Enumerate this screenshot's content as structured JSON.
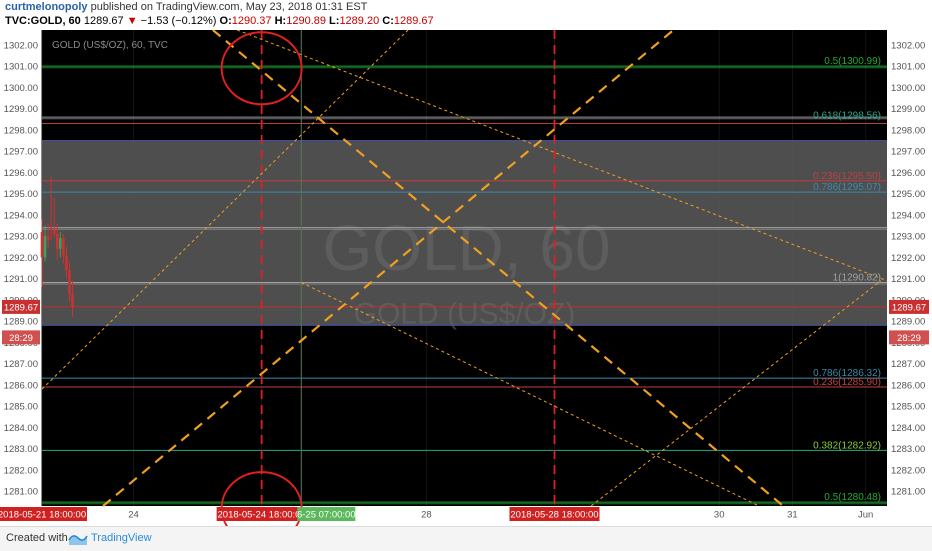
{
  "header": {
    "author": "curtmelonopoly",
    "published": "published on TradingView.com, May 23, 2018 01:31 EST",
    "symbol": "TVC:GOLD, 60",
    "last": "1289.67",
    "change_arrow": "▼",
    "change": "−1.53 (−0.12%)",
    "o_label": "O:",
    "o_val": "1290.37",
    "h_label": "H:",
    "h_val": "1290.89",
    "l_label": "L:",
    "l_val": "1289.20",
    "c_label": "C:",
    "c_val": "1289.67"
  },
  "chart_data": {
    "type": "candlestick",
    "legend": "GOLD (US$/OZ), 60, TVC",
    "watermark_title": "GOLD, 60",
    "watermark_subtitle": "GOLD (US$/OZ)",
    "ylim": [
      1280.3,
      1302.7
    ],
    "y_ticks": [
      "1302.00",
      "1301.00",
      "1300.00",
      "1299.00",
      "1298.00",
      "1297.00",
      "1296.00",
      "1295.00",
      "1294.00",
      "1293.00",
      "1292.00",
      "1291.00",
      "1290.00",
      "1289.00",
      "1288.00",
      "1287.00",
      "1286.00",
      "1285.00",
      "1284.00",
      "1283.00",
      "1282.00",
      "1281.00"
    ],
    "x_range": [
      "2018-05-21 18:00",
      "2018-06-01 12:00"
    ],
    "x_ticks": [
      {
        "label": "2018-05-21 18:00:00",
        "t": 0,
        "highlight": "red"
      },
      {
        "label": "24",
        "t": 30
      },
      {
        "label": "2018-05-24 18:00:00",
        "t": 72,
        "highlight": "red"
      },
      {
        "label": "6-25 07:00:00",
        "t": 85,
        "highlight": "green"
      },
      {
        "label": "28",
        "t": 126
      },
      {
        "label": "2018-05-28 18:00:00",
        "t": 168,
        "highlight": "red"
      },
      {
        "label": "30",
        "t": 222
      },
      {
        "label": "31",
        "t": 246
      },
      {
        "label": "Jun",
        "t": 270
      }
    ],
    "price_badges": [
      {
        "label": "1289.67",
        "price": 1289.67
      },
      {
        "label": "28:29",
        "price": 1288.8
      }
    ],
    "candles": [
      {
        "t": 0,
        "o": 1293.2,
        "h": 1293.8,
        "l": 1290.6,
        "c": 1292.0
      },
      {
        "t": 1,
        "o": 1292.0,
        "h": 1293.5,
        "l": 1291.8,
        "c": 1293.0
      },
      {
        "t": 2,
        "o": 1293.0,
        "h": 1293.6,
        "l": 1292.4,
        "c": 1292.8
      },
      {
        "t": 3,
        "o": 1293.4,
        "h": 1295.8,
        "l": 1292.8,
        "c": 1293.3
      },
      {
        "t": 4,
        "o": 1293.3,
        "h": 1294.8,
        "l": 1292.9,
        "c": 1293.1
      },
      {
        "t": 5,
        "o": 1293.1,
        "h": 1293.6,
        "l": 1291.9,
        "c": 1292.4
      },
      {
        "t": 6,
        "o": 1292.4,
        "h": 1293.2,
        "l": 1292.0,
        "c": 1292.9
      },
      {
        "t": 7,
        "o": 1292.9,
        "h": 1293.1,
        "l": 1291.7,
        "c": 1292.1
      },
      {
        "t": 8,
        "o": 1292.1,
        "h": 1292.5,
        "l": 1291.0,
        "c": 1291.4
      },
      {
        "t": 9,
        "o": 1291.4,
        "h": 1291.8,
        "l": 1289.9,
        "c": 1290.3
      },
      {
        "t": 10,
        "o": 1290.3,
        "h": 1290.9,
        "l": 1289.2,
        "c": 1289.67
      }
    ],
    "gray_box": {
      "top": 1297.5,
      "bottom": 1288.8
    },
    "h_lines": [
      {
        "price": 1301.0,
        "color": "#22aa33",
        "double": true
      },
      {
        "price": 1298.6,
        "color": "#9a9a9a",
        "double": true
      },
      {
        "price": 1298.3,
        "color": "#b04040"
      },
      {
        "price": 1297.5,
        "color": "#3f4fa8"
      },
      {
        "price": 1295.6,
        "color": "#c04040"
      },
      {
        "price": 1295.07,
        "color": "#3a8aaa"
      },
      {
        "price": 1293.4,
        "color": "#a0a0a0",
        "double": true
      },
      {
        "price": 1290.82,
        "color": "#a0a0a0",
        "double": true
      },
      {
        "price": 1289.67,
        "color": "#c03030"
      },
      {
        "price": 1288.8,
        "color": "#3f4fa8"
      },
      {
        "price": 1286.32,
        "color": "#3a8aaa"
      },
      {
        "price": 1285.9,
        "color": "#c04040"
      },
      {
        "price": 1282.92,
        "color": "#22aa88"
      },
      {
        "price": 1280.48,
        "color": "#22aa33",
        "double": true
      }
    ],
    "fib_labels": [
      {
        "text": "0.5(1300.99)",
        "price": 1301.0,
        "color": "#22aa33"
      },
      {
        "text": "0.618(1298.56)",
        "price": 1298.45,
        "color": "#22aa88"
      },
      {
        "text": "0.236(1295.50)",
        "price": 1295.6,
        "color": "#c04040"
      },
      {
        "text": "0.786(1295.07)",
        "price": 1295.07,
        "color": "#3a8aaa"
      },
      {
        "text": "1(1290.82)",
        "price": 1290.82,
        "color": "#a0a0a0"
      },
      {
        "text": "0.786(1286.32)",
        "price": 1286.32,
        "color": "#3a8aaa"
      },
      {
        "text": "0.236(1285.90)",
        "price": 1285.9,
        "color": "#c04040"
      },
      {
        "text": "0.382(1282.92)",
        "price": 1282.92,
        "color": "#8ccc33"
      },
      {
        "text": "0.5(1280.48)",
        "price": 1280.48,
        "color": "#22aa33"
      }
    ],
    "v_lines": [
      {
        "t": 72,
        "color": "#e02020",
        "dash": true
      },
      {
        "t": 85,
        "color": "#557755",
        "dash": false
      },
      {
        "t": 168,
        "color": "#e02020",
        "dash": true
      }
    ],
    "diag_lines": [
      {
        "t1": 56,
        "p1": 1302.7,
        "t2": 243,
        "p2": 1280.3,
        "color": "#f0a020",
        "width": 2.2,
        "dash": "10,7"
      },
      {
        "t1": 20,
        "p1": 1280.3,
        "t2": 207,
        "p2": 1302.7,
        "color": "#f0a020",
        "width": 2.2,
        "dash": "10,7"
      },
      {
        "t1": 64,
        "p1": 1302.7,
        "t2": 277,
        "p2": 1290.9,
        "color": "#f0a020",
        "width": 1,
        "dash": "3,3"
      },
      {
        "t1": 0,
        "p1": 1285.8,
        "t2": 120,
        "p2": 1302.7,
        "color": "#f0a020",
        "width": 1,
        "dash": "3,3"
      },
      {
        "t1": 85,
        "p1": 1290.82,
        "t2": 235,
        "p2": 1280.3,
        "color": "#f0a020",
        "width": 1,
        "dash": "3,3"
      },
      {
        "t1": 180,
        "p1": 1280.3,
        "t2": 275,
        "p2": 1290.9,
        "color": "#f0a020",
        "width": 1,
        "dash": "3,3"
      }
    ],
    "circles": [
      {
        "t": 72,
        "p": 1300.9,
        "color": "#e02020"
      },
      {
        "t": 72,
        "p": 1280.2,
        "color": "#e02020"
      }
    ]
  },
  "footer": {
    "created_with": "Created with",
    "brand": "TradingView"
  },
  "colors": {
    "background": "#000000",
    "up": "#3ca060",
    "down": "#d03030",
    "accent": "#2962a6"
  }
}
